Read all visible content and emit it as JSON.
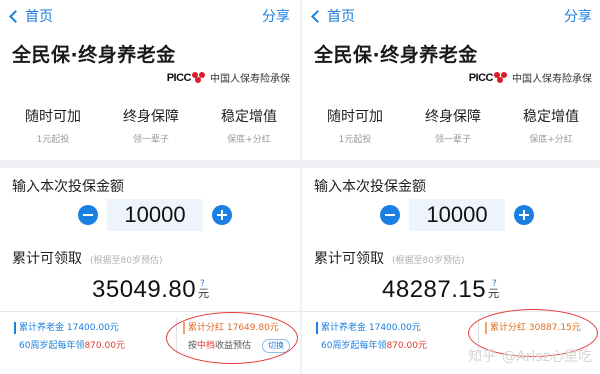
{
  "panels": [
    {
      "nav": {
        "back_label": "首页",
        "share_label": "分享"
      },
      "title": "全民保·终身养老金",
      "brand": {
        "picc": "PICC",
        "company": "中国人保寿险承保"
      },
      "features": [
        {
          "title": "随时可加",
          "sub": "1元起投"
        },
        {
          "title": "终身保障",
          "sub": "领一辈子"
        },
        {
          "title": "稳定增值",
          "sub": "保底+分红"
        }
      ],
      "input_label": "输入本次投保金额",
      "amount": "10000",
      "total_label": "累计可领取",
      "total_note": "(根据至80岁预估)",
      "total_value": "35049.80",
      "total_unit": "元",
      "help": "?",
      "details": {
        "pension": "累计养老金 17400.00元",
        "annual_prefix": "60周岁起每年领",
        "annual_value": "870.00元",
        "dividend": "累计分红 17649.80元",
        "dividend_prefix": "按",
        "dividend_level": "中档",
        "dividend_suffix": "收益预估",
        "switch_label": "切换"
      }
    },
    {
      "nav": {
        "back_label": "首页",
        "share_label": "分享"
      },
      "title": "全民保·终身养老金",
      "brand": {
        "picc": "PICC",
        "company": "中国人保寿险承保"
      },
      "features": [
        {
          "title": "随时可加",
          "sub": "1元起投"
        },
        {
          "title": "终身保障",
          "sub": "领一辈子"
        },
        {
          "title": "稳定增值",
          "sub": "保底+分红"
        }
      ],
      "input_label": "输入本次投保金额",
      "amount": "10000",
      "total_label": "累计可领取",
      "total_note": "(根据至80岁预估)",
      "total_value": "48287.15",
      "total_unit": "元",
      "help": "?",
      "details": {
        "pension": "累计养老金 17400.00元",
        "annual_prefix": "60周岁起每年领",
        "annual_value": "870.00元",
        "dividend": "累计分红 30887.15元"
      }
    }
  ],
  "watermark": {
    "site": "知乎",
    "handle": "@Arlsz心里吃"
  },
  "colors": {
    "accent": "#1a7fe0",
    "annotation": "#e13b3b",
    "dividend": "#e36a1d"
  }
}
